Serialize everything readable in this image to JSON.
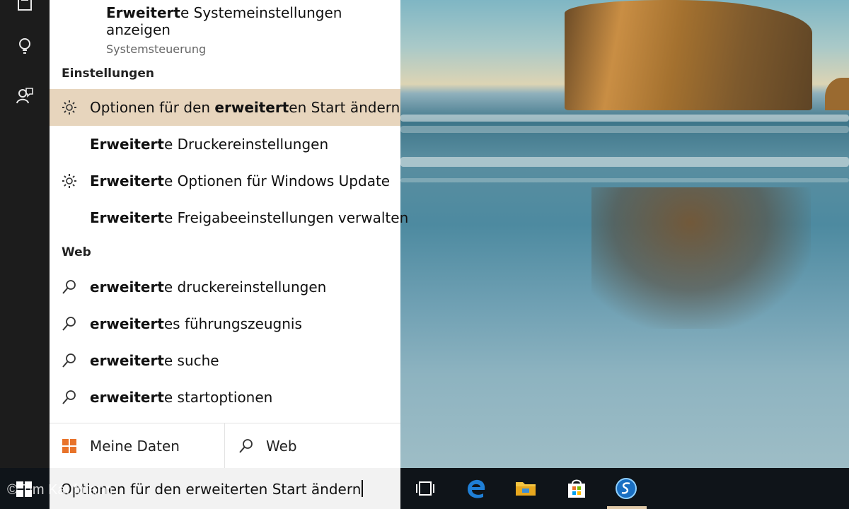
{
  "top_result": {
    "title_bold": "Erweitert",
    "title_rest": "e Systemeinstellungen anzeigen",
    "subtitle": "Systemsteuerung"
  },
  "sections": {
    "settings_label": "Einstellungen",
    "web_label": "Web"
  },
  "settings_items": [
    {
      "pre": "Optionen für den ",
      "bold": "erweitert",
      "post": "en Start ändern",
      "icon": "gear-icon",
      "selected": true
    },
    {
      "pre": "",
      "bold": "Erweitert",
      "post": "e Druckereinstellungen",
      "icon": "",
      "selected": false
    },
    {
      "pre": "",
      "bold": "Erweitert",
      "post": "e Optionen für Windows Update",
      "icon": "gear-icon",
      "selected": false
    },
    {
      "pre": "",
      "bold": "Erweitert",
      "post": "e Freigabeeinstellungen verwalten",
      "icon": "",
      "selected": false
    }
  ],
  "web_items": [
    {
      "bold": "erweitert",
      "post": "e druckereinstellungen",
      "icon": "search-icon"
    },
    {
      "bold": "erweitert",
      "post": "es führungszeugnis",
      "icon": "search-icon"
    },
    {
      "bold": "erweitert",
      "post": "e suche",
      "icon": "search-icon"
    },
    {
      "bold": "erweitert",
      "post": "e startoptionen",
      "icon": "search-icon"
    }
  ],
  "filters": {
    "my_stuff": "Meine Daten",
    "web": "Web"
  },
  "search": {
    "query": "Optionen für den erweiterten Start ändern"
  },
  "watermark": "© Tim Kaufmann",
  "colors": {
    "selected_row": "#e7d5bd",
    "taskbar": "#0f1419",
    "rail": "#1c1c1c",
    "edge_blue": "#1f7fd6",
    "folder_yellow": "#f4c542",
    "windows_orange": "#e8732a"
  }
}
